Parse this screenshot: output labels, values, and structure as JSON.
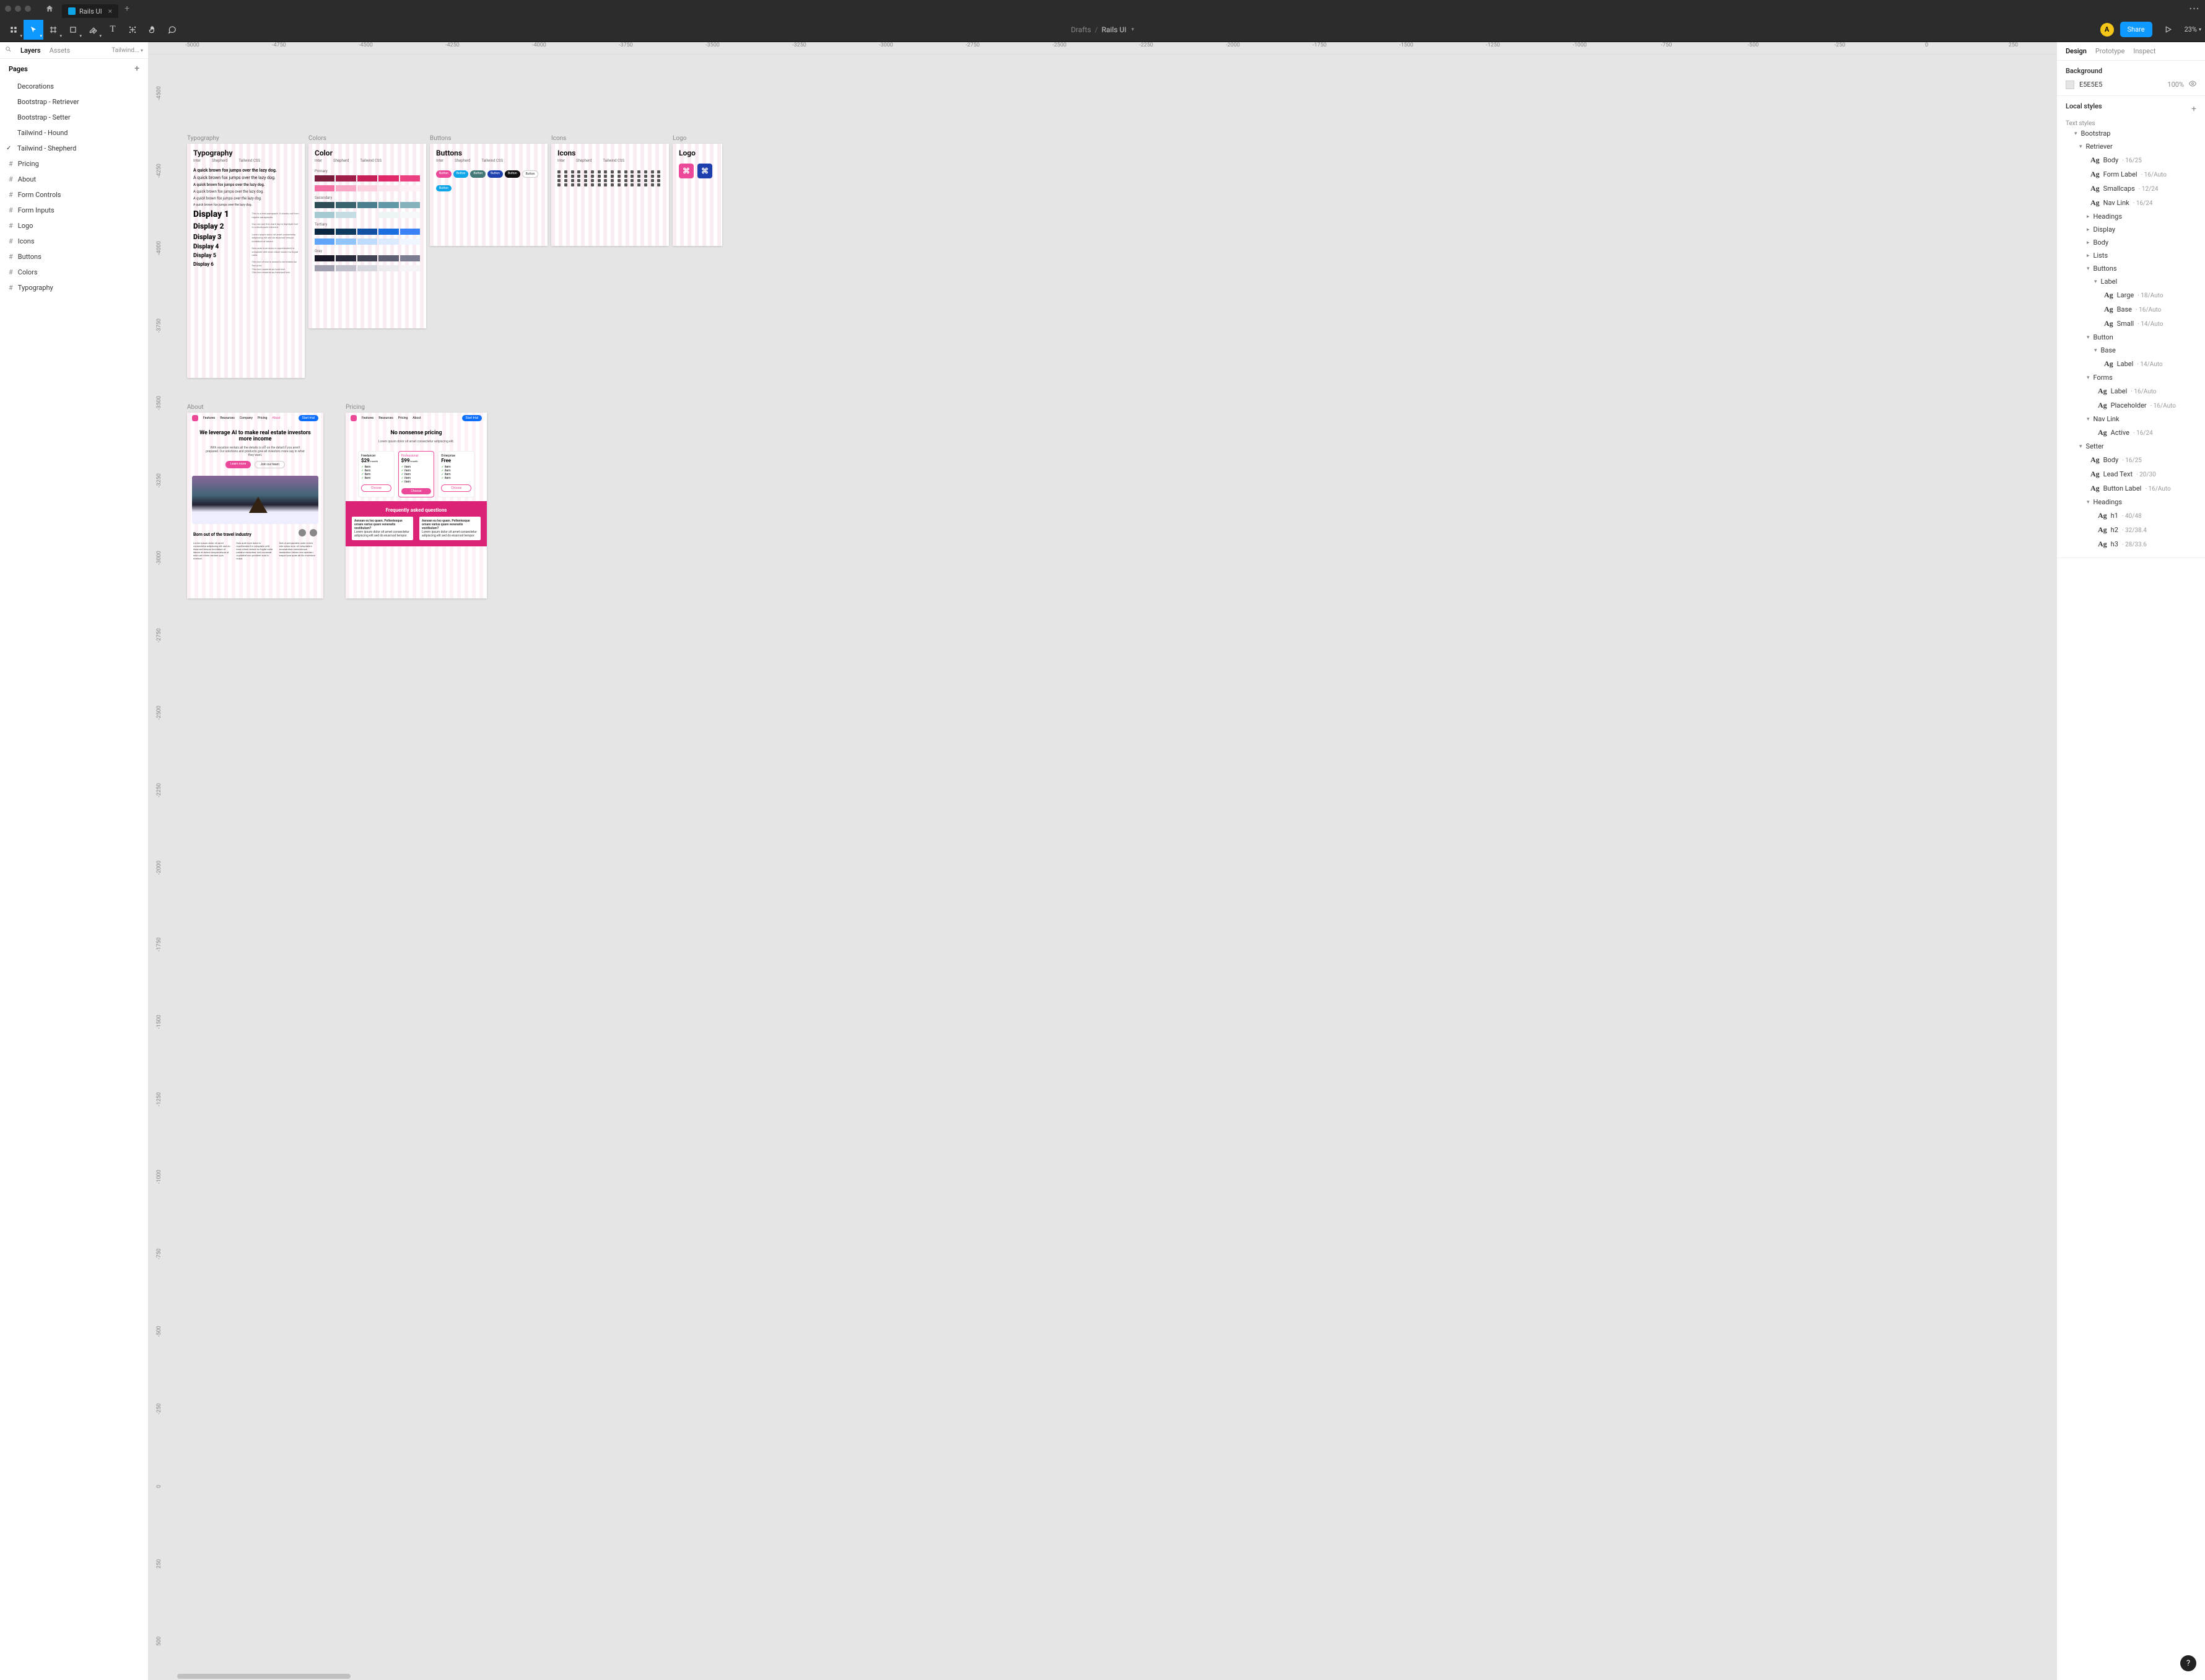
{
  "tab": {
    "title": "Rails UI"
  },
  "doc": {
    "location": "Drafts",
    "name": "Rails UI"
  },
  "avatar": "A",
  "share": "Share",
  "zoom": "23%",
  "leftPanel": {
    "tabs": {
      "layers": "Layers",
      "assets": "Assets",
      "pagename": "Tailwind..."
    },
    "pagesHeader": "Pages",
    "pages": [
      "Decorations",
      "Bootstrap - Retriever",
      "Bootstrap - Setter",
      "Tailwind - Hound",
      "Tailwind - Shepherd"
    ],
    "currentPageIndex": 4,
    "layers": [
      "Pricing",
      "About",
      "Form Controls",
      "Form Inputs",
      "Logo",
      "Icons",
      "Buttons",
      "Colors",
      "Typography"
    ]
  },
  "rulerH": [
    "-5000",
    "-4750",
    "-4500",
    "-4250",
    "-4000",
    "-3750",
    "-3500",
    "-3250",
    "-3000",
    "-2750",
    "-2500",
    "-2250",
    "-2000",
    "-1750",
    "-1500",
    "-1250",
    "-1000",
    "-750",
    "-500",
    "-250",
    "0",
    "250"
  ],
  "rulerV": [
    "-4500",
    "-4250",
    "-4000",
    "-3750",
    "-3500",
    "-3250",
    "-3000",
    "-2750",
    "-2500",
    "-2250",
    "-2000",
    "-1750",
    "-1500",
    "-1250",
    "-1000",
    "-750",
    "-500",
    "-250",
    "0",
    "250",
    "500"
  ],
  "frames": {
    "typography": {
      "label": "Typography",
      "title": "Typography",
      "meta": [
        "Inter",
        "Shepherd",
        "Tailwind CSS"
      ],
      "sample": "A quick brown fox jumps over the lazy dog.",
      "displays": [
        "Display 1",
        "Display 2",
        "Display 3",
        "Display 4",
        "Display 5",
        "Display 6"
      ]
    },
    "colors": {
      "label": "Colors",
      "title": "Color",
      "caps": [
        "Primary",
        "Secondary",
        "Tertiary",
        "Gray"
      ]
    },
    "buttons": {
      "label": "Buttons",
      "title": "Buttons"
    },
    "icons": {
      "label": "Icons",
      "title": "Icons"
    },
    "logo": {
      "label": "Logo",
      "title": "Logo"
    },
    "about": {
      "label": "About",
      "nav": [
        "Features",
        "Resources",
        "Company",
        "Pricing",
        "About"
      ],
      "cta": "Start trial",
      "hero": "We leverage AI to make real estate investors more income",
      "sub": "With vacation rentals all the details is off on the detail if you aren't prepared. Our solutions and products give all investors more say in what they want.",
      "heroBtn1": "Learn more",
      "heroBtn2": "Join our team",
      "h2": "Born out of the travel industry"
    },
    "pricing": {
      "label": "Pricing",
      "hero": "No nonsense pricing",
      "cards": [
        {
          "name": "Freelancer",
          "price": "$29",
          "period": "/month"
        },
        {
          "name": "Professional",
          "price": "$99",
          "period": "/month"
        },
        {
          "name": "Enterprise",
          "price": "Free"
        }
      ],
      "faq": "Frequently asked questions"
    }
  },
  "rightPanel": {
    "tabs": [
      "Design",
      "Prototype",
      "Inspect"
    ],
    "activeTab": 0,
    "bg": {
      "title": "Background",
      "hex": "E5E5E5",
      "opacity": "100%"
    },
    "localStyles": "Local styles",
    "textStyles": "Text styles",
    "tree": [
      {
        "type": "group",
        "depth": 0,
        "label": "Bootstrap",
        "open": true
      },
      {
        "type": "group",
        "depth": 1,
        "label": "Retriever",
        "open": true
      },
      {
        "type": "leaf",
        "depth": 2,
        "name": "Body",
        "meta": "16/25"
      },
      {
        "type": "leaf",
        "depth": 2,
        "name": "Form Label",
        "meta": "16/Auto"
      },
      {
        "type": "leaf",
        "depth": 2,
        "name": "Smallcaps",
        "meta": "12/24"
      },
      {
        "type": "leaf",
        "depth": 2,
        "name": "Nav Link",
        "meta": "16/24"
      },
      {
        "type": "group",
        "depth": 2,
        "label": "Headings",
        "open": false
      },
      {
        "type": "group",
        "depth": 2,
        "label": "Display",
        "open": false
      },
      {
        "type": "group",
        "depth": 2,
        "label": "Body",
        "open": false
      },
      {
        "type": "group",
        "depth": 2,
        "label": "Lists",
        "open": false
      },
      {
        "type": "group",
        "depth": 2,
        "label": "Buttons",
        "open": true
      },
      {
        "type": "group",
        "depth": 3,
        "label": "Label",
        "open": true
      },
      {
        "type": "leaf",
        "depth": 4,
        "name": "Large",
        "meta": "18/Auto"
      },
      {
        "type": "leaf",
        "depth": 4,
        "name": "Base",
        "meta": "16/Auto"
      },
      {
        "type": "leaf",
        "depth": 4,
        "name": "Small",
        "meta": "14/Auto"
      },
      {
        "type": "group",
        "depth": 2,
        "label": "Button",
        "open": true
      },
      {
        "type": "group",
        "depth": 3,
        "label": "Base",
        "open": true
      },
      {
        "type": "leaf",
        "depth": 4,
        "name": "Label",
        "meta": "14/Auto"
      },
      {
        "type": "group",
        "depth": 2,
        "label": "Forms",
        "open": true
      },
      {
        "type": "leaf",
        "depth": 3,
        "name": "Label",
        "meta": "16/Auto"
      },
      {
        "type": "leaf",
        "depth": 3,
        "name": "Placeholder",
        "meta": "16/Auto"
      },
      {
        "type": "group",
        "depth": 2,
        "label": "Nav Link",
        "open": true
      },
      {
        "type": "leaf",
        "depth": 3,
        "name": "Active",
        "meta": "16/24"
      },
      {
        "type": "group",
        "depth": 1,
        "label": "Setter",
        "open": true
      },
      {
        "type": "leaf",
        "depth": 2,
        "name": "Body",
        "meta": "16/25"
      },
      {
        "type": "leaf",
        "depth": 2,
        "name": "Lead Text",
        "meta": "20/30"
      },
      {
        "type": "leaf",
        "depth": 2,
        "name": "Button Label",
        "meta": "16/Auto"
      },
      {
        "type": "group",
        "depth": 2,
        "label": "Headings",
        "open": true
      },
      {
        "type": "leaf",
        "depth": 3,
        "name": "h1",
        "meta": "40/48"
      },
      {
        "type": "leaf",
        "depth": 3,
        "name": "h2",
        "meta": "32/38.4"
      },
      {
        "type": "leaf",
        "depth": 3,
        "name": "h3",
        "meta": "28/33.6"
      }
    ]
  }
}
